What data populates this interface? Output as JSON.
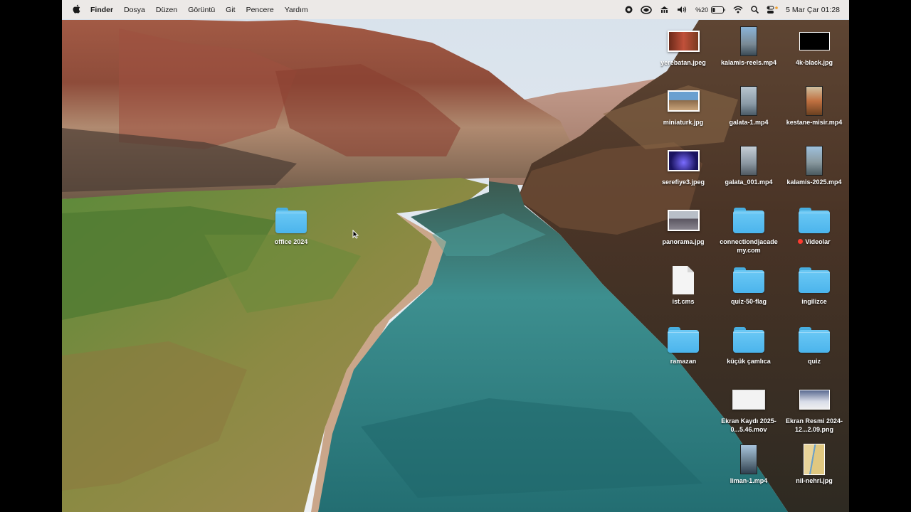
{
  "menubar": {
    "apple_icon": "apple-icon",
    "app_name": "Finder",
    "menus": [
      "Dosya",
      "Düzen",
      "Görüntü",
      "Git",
      "Pencere",
      "Yardım"
    ],
    "status": {
      "icons": [
        "record-icon",
        "vpn-icon",
        "display-icon",
        "volume-icon",
        "battery-icon",
        "wifi-icon",
        "search-icon",
        "control-center-icon"
      ],
      "battery_text": "%20",
      "datetime": "5 Mar Çar  01:28"
    }
  },
  "desktop": {
    "items": [
      {
        "name": "yerebatan.jpeg",
        "kind": "image"
      },
      {
        "name": "kalamis-reels.mp4",
        "kind": "video"
      },
      {
        "name": "4k-black.jpg",
        "kind": "image"
      },
      {
        "name": "miniaturk.jpg",
        "kind": "image"
      },
      {
        "name": "galata-1.mp4",
        "kind": "video"
      },
      {
        "name": "kestane-misir.mp4",
        "kind": "video"
      },
      {
        "name": "serefiye3.jpeg",
        "kind": "image"
      },
      {
        "name": "galata_001.mp4",
        "kind": "video"
      },
      {
        "name": "kalamis-2025.mp4",
        "kind": "video"
      },
      {
        "name": "panorama.jpg",
        "kind": "image"
      },
      {
        "name": "connectiondjacade my.com",
        "kind": "folder"
      },
      {
        "name": "Videolar",
        "kind": "folder",
        "tag": "red"
      },
      {
        "name": "ist.cms",
        "kind": "document"
      },
      {
        "name": "quiz-50-flag",
        "kind": "folder"
      },
      {
        "name": "ingilizce",
        "kind": "folder"
      },
      {
        "name": "ramazan",
        "kind": "folder"
      },
      {
        "name": "küçük çamlıca",
        "kind": "folder"
      },
      {
        "name": "quiz",
        "kind": "folder"
      },
      {
        "name": "Ekran Kaydı 2025-0...5.46.mov",
        "kind": "video"
      },
      {
        "name": "Ekran Resmi 2024-12...2.09.png",
        "kind": "image"
      },
      {
        "name": "liman-1.mp4",
        "kind": "video"
      },
      {
        "name": "nil-nehri.jpg",
        "kind": "image"
      },
      {
        "name": "office 2024",
        "kind": "folder"
      }
    ]
  },
  "colors": {
    "folder": "#5ec0f2",
    "menubar_bg": "#ece9e6",
    "river": "#2f8d8e",
    "tag_red": "#ff3b30"
  }
}
